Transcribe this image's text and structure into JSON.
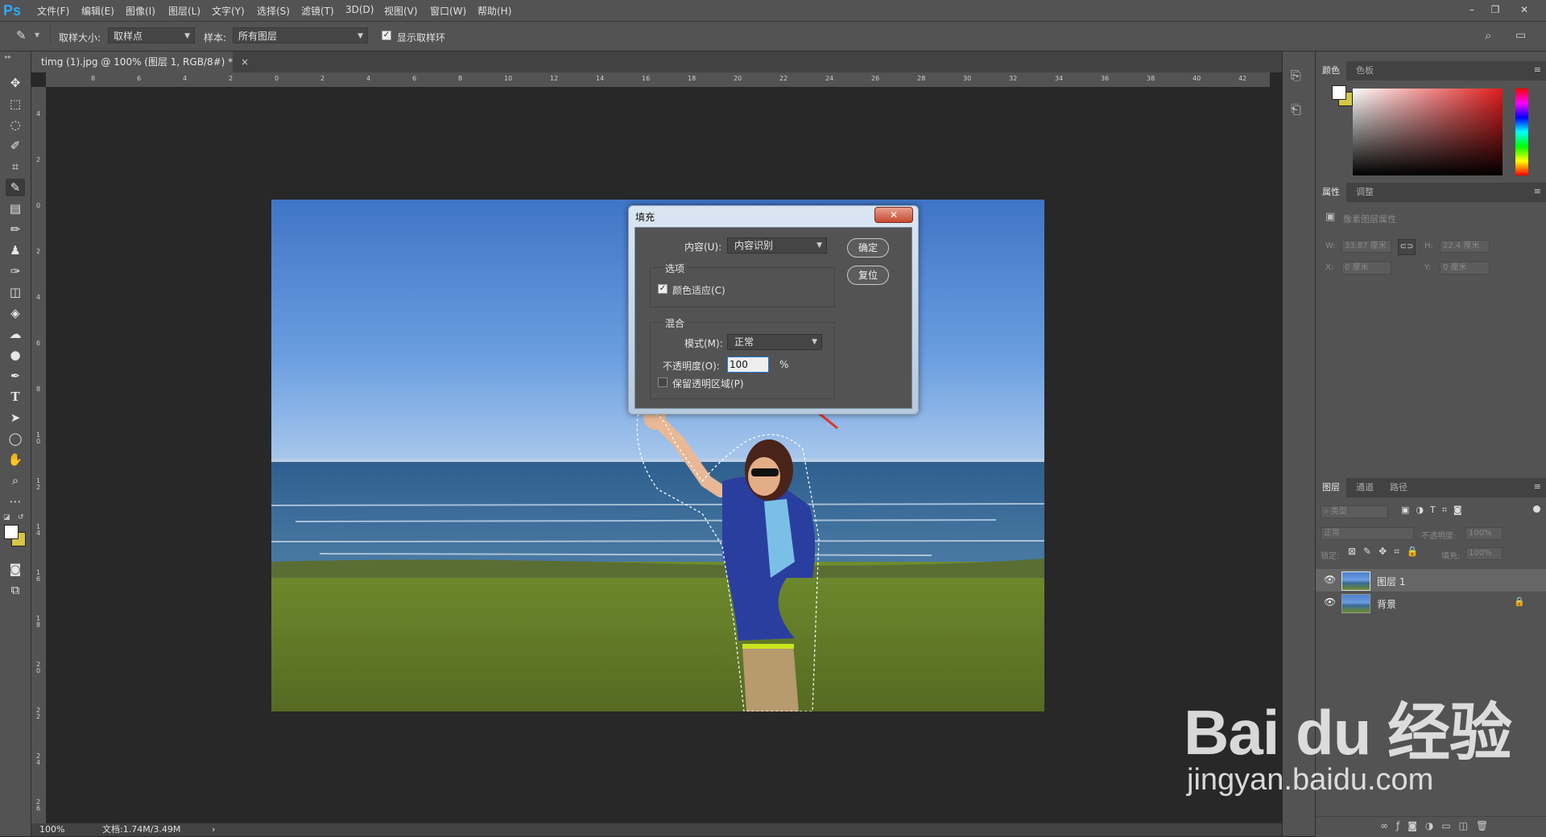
{
  "app": {
    "logo": "Ps"
  },
  "menu": [
    "文件(F)",
    "编辑(E)",
    "图像(I)",
    "图层(L)",
    "文字(Y)",
    "选择(S)",
    "滤镜(T)",
    "3D(D)",
    "视图(V)",
    "窗口(W)",
    "帮助(H)"
  ],
  "window_controls": {
    "minimize": "–",
    "restore": "❐",
    "close": "✕"
  },
  "options_bar": {
    "sample_size_label": "取样大小:",
    "sample_size_value": "取样点",
    "sample_label": "样本:",
    "sample_value": "所有图层",
    "show_ring_label": "显示取样环",
    "show_ring_checked": true
  },
  "document": {
    "tab_title": "timg (1).jpg @ 100% (图层 1, RGB/8#) *",
    "tab_close": "×",
    "zoom": "100%",
    "doc_info": "文档:1.74M/3.49M",
    "status_arrow": "›"
  },
  "rulers": {
    "h_ticks": [
      "8",
      "6",
      "4",
      "2",
      "0",
      "2",
      "4",
      "6",
      "8",
      "10",
      "12",
      "14",
      "16",
      "18",
      "20",
      "22",
      "24",
      "26",
      "28",
      "30",
      "32",
      "34",
      "36",
      "38",
      "40",
      "42"
    ],
    "v_ticks": [
      "4",
      "2",
      "0",
      "2",
      "4",
      "6",
      "8",
      "1 0",
      "1 2",
      "1 4",
      "1 6",
      "1 8",
      "2 0",
      "2 2",
      "2 4",
      "2 6"
    ]
  },
  "color_panel": {
    "tabs": [
      "颜色",
      "色板"
    ]
  },
  "properties_panel": {
    "tabs": [
      "属性",
      "调整"
    ],
    "title": "像素图层属性",
    "w_label": "W:",
    "w_value": "33.87 厘米",
    "h_label": "H:",
    "h_value": "22.4 厘米",
    "x_label": "X:",
    "x_value": "0 厘米",
    "y_label": "Y:",
    "y_value": "0 厘米"
  },
  "layers_panel": {
    "tabs": [
      "图层",
      "通道",
      "路径"
    ],
    "filter_label": "类型",
    "blend_mode": "正常",
    "opacity_label": "不透明度:",
    "opacity_value": "100%",
    "lock_label": "锁定:",
    "fill_label": "填充:",
    "fill_value": "100%",
    "layers": [
      {
        "name": "图层 1",
        "visible": true,
        "selected": true
      },
      {
        "name": "背景",
        "visible": true,
        "locked": true
      }
    ]
  },
  "fill_dialog": {
    "title": "填充",
    "close": "✕",
    "content_label": "内容(U):",
    "content_value": "内容识别",
    "ok": "确定",
    "reset": "复位",
    "options_group": "选项",
    "color_adapt_label": "颜色适应(C)",
    "color_adapt_checked": true,
    "blend_group": "混合",
    "mode_label": "模式(M):",
    "mode_value": "正常",
    "opacity_label": "不透明度(O):",
    "opacity_value": "100",
    "percent": "%",
    "preserve_label": "保留透明区域(P)",
    "preserve_checked": false
  },
  "watermark": {
    "line1": "Bai du 经验",
    "line2": "jingyan.baidu.com"
  },
  "colors": {
    "accent": "#1e78d6",
    "arrow": "#e8322a",
    "foreground": "#ffffff",
    "background": "#d6c646"
  }
}
